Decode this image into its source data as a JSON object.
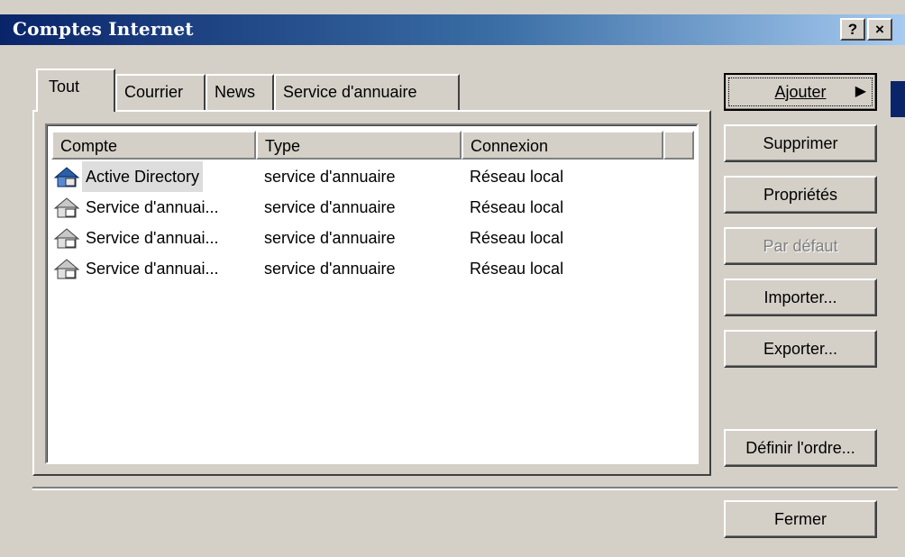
{
  "window": {
    "title": "Comptes Internet",
    "help_button": "?",
    "close_button": "×"
  },
  "tabs": [
    {
      "label": "Tout"
    },
    {
      "label": "Courrier"
    },
    {
      "label": "News"
    },
    {
      "label": "Service d'annuaire"
    }
  ],
  "table": {
    "columns": [
      "Compte",
      "Type",
      "Connexion"
    ],
    "rows": [
      {
        "account": "Active Directory",
        "type": "service d'annuaire",
        "connection": "Réseau local",
        "icon": "directory-service-icon"
      },
      {
        "account": "Service d'annuai...",
        "type": "service d'annuaire",
        "connection": "Réseau local",
        "icon": "directory-service-icon"
      },
      {
        "account": "Service d'annuai...",
        "type": "service d'annuaire",
        "connection": "Réseau local",
        "icon": "directory-service-icon"
      },
      {
        "account": "Service d'annuai...",
        "type": "service d'annuaire",
        "connection": "Réseau local",
        "icon": "directory-service-icon"
      }
    ]
  },
  "buttons": {
    "add": "Ajouter",
    "add_arrow": "▶",
    "delete": "Supprimer",
    "properties": "Propriétés",
    "default": "Par défaut",
    "import": "Importer...",
    "export": "Exporter...",
    "order": "Définir l'ordre...",
    "close": "Fermer"
  }
}
